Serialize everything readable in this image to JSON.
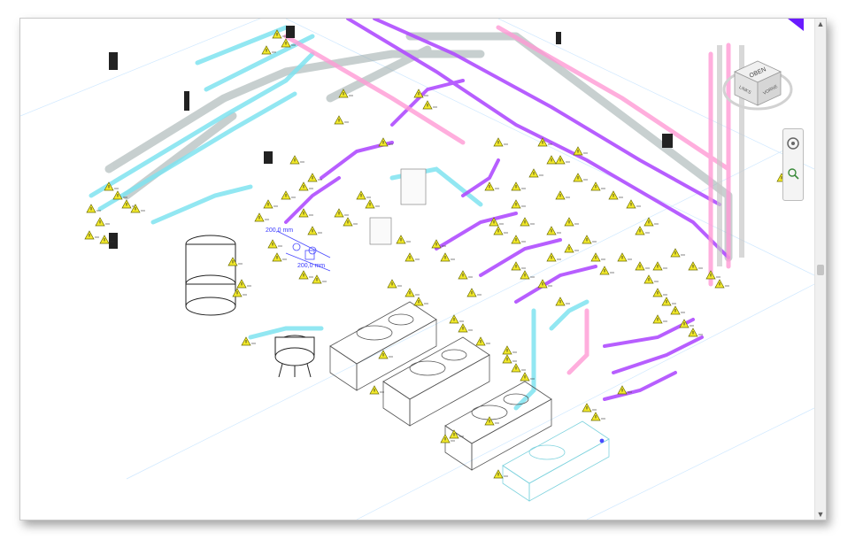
{
  "viewcube": {
    "face_label": "OBEN",
    "left_label": "LINKS",
    "front_label": "VORNE"
  },
  "dimensions": {
    "dim_upper": "200,0 mm",
    "dim_lower": "200,0 mm"
  },
  "colors": {
    "cyan": "#7fe3f0",
    "magenta": "#c060ff",
    "pink": "#ff8fd0",
    "gray": "#8aa0a0",
    "warn": "#f3ea2a",
    "accent": "#6a1bff"
  },
  "icons": {
    "warning": "warning-triangle-icon",
    "steering_wheel": "steering-wheel-icon",
    "zoom": "zoom-icon",
    "scroll_up": "chevron-up-icon",
    "scroll_down": "chevron-down-icon"
  },
  "scrollbar": {
    "up_glyph": "▲",
    "down_glyph": "▼"
  }
}
